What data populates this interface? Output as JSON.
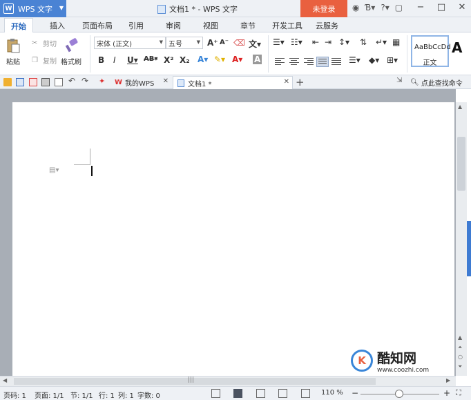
{
  "app": {
    "name": "WPS 文字",
    "brand_color": "#4a83d4"
  },
  "window": {
    "title": "文档1 * - WPS 文字",
    "login_label": "未登录",
    "login_color": "#e9603f"
  },
  "ribbon_tabs": [
    "开始",
    "插入",
    "页面布局",
    "引用",
    "审阅",
    "视图",
    "章节",
    "开发工具",
    "云服务"
  ],
  "clipboard": {
    "paste": "粘贴",
    "cut": "剪切",
    "copy": "复制",
    "format_painter": "格式刷"
  },
  "font": {
    "family": "宋体 (正文)",
    "size": "五号"
  },
  "styles": {
    "sample": "AaBbCcDd",
    "normal": "正文"
  },
  "doc_tabs": [
    {
      "label": "我的WPS"
    },
    {
      "label": "文档1 *"
    }
  ],
  "find_command": "点此查找命令",
  "status": {
    "page": "页码: 1",
    "pages": "页面: 1/1",
    "section": "节: 1/1",
    "row": "行: 1",
    "col": "列: 1",
    "words": "字数: 0",
    "zoom": "110 %"
  },
  "watermark": {
    "text": "酷知网",
    "url": "www.coozhi.com"
  }
}
